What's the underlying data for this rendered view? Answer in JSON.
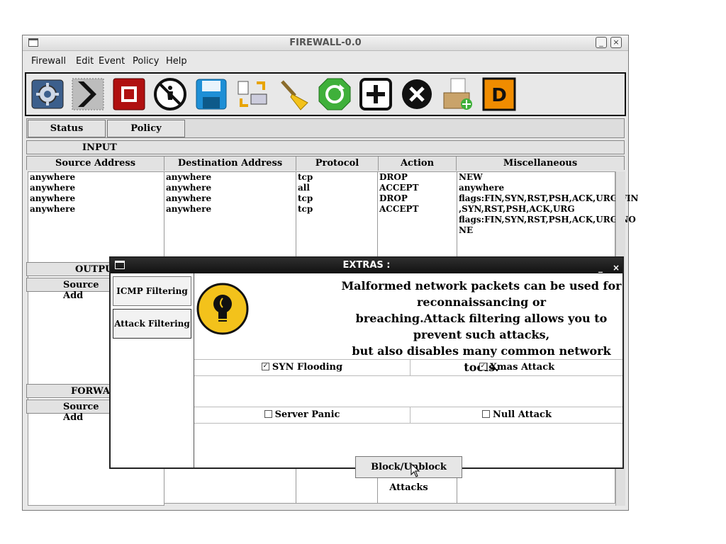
{
  "window": {
    "title": "FIREWALL-0.0",
    "minimize_glyph": "_",
    "close_glyph": "×"
  },
  "menu": [
    "Firewall",
    "Edit",
    "Event",
    "Policy",
    "Help"
  ],
  "toolbar": {
    "icons": [
      "settings-icon",
      "play-icon",
      "stop-icon",
      "no-access-icon",
      "save-icon",
      "transfer-icon",
      "clean-brush-icon",
      "refresh-icon",
      "add-icon",
      "delete-icon",
      "add-package-icon",
      "d-icon"
    ],
    "d_letter": "D"
  },
  "tabs": [
    "Status",
    "Policy"
  ],
  "input_section": {
    "title": "INPUT",
    "columns": [
      "Source Address",
      "Destination Address",
      "Protocol",
      "Action",
      "Miscellaneous"
    ],
    "source": [
      "anywhere",
      "anywhere",
      "anywhere",
      "anywhere"
    ],
    "destination": [
      "anywhere",
      "anywhere",
      "anywhere",
      "anywhere"
    ],
    "protocol": [
      "tcp",
      "all",
      "tcp",
      "tcp"
    ],
    "action": [
      "DROP",
      "ACCEPT",
      "DROP",
      "ACCEPT"
    ],
    "misc": [
      "NEW",
      "anywhere",
      "flags:FIN,SYN,RST,PSH,ACK,URG/FIN",
      ",SYN,RST,PSH,ACK,URG",
      "flags:FIN,SYN,RST,PSH,ACK,URG/NO",
      "NE"
    ]
  },
  "output_section": {
    "title": "OUTPU",
    "col": "Source Add"
  },
  "forward_section": {
    "title": "FORWA",
    "col": "Source Add"
  },
  "dialog": {
    "title": "EXTRAS :",
    "minimize_glyph": "_",
    "close_glyph": "×",
    "side_tabs": [
      "ICMP Filtering",
      "Attack Filtering"
    ],
    "message_lines": [
      "Malformed network packets can be used for reconnaissancing or",
      "breaching.Attack filtering allows you to prevent such attacks,",
      "but also disables many common network tools."
    ],
    "options": [
      {
        "label": "SYN Flooding",
        "checked": true,
        "mark": "✓"
      },
      {
        "label": "Xmas Attack",
        "checked": true,
        "mark": "✓"
      },
      {
        "label": "Server Panic",
        "checked": false,
        "mark": ""
      },
      {
        "label": "Null Attack",
        "checked": false,
        "mark": ""
      }
    ],
    "action_button": "Block/Unblock Attacks"
  },
  "colors": {
    "dialog_title_bg": "#111111",
    "bulb_yellow": "#f3c21b",
    "stop_red": "#b01010",
    "d_orange": "#f08c00",
    "refresh_green": "#3fb03a"
  }
}
